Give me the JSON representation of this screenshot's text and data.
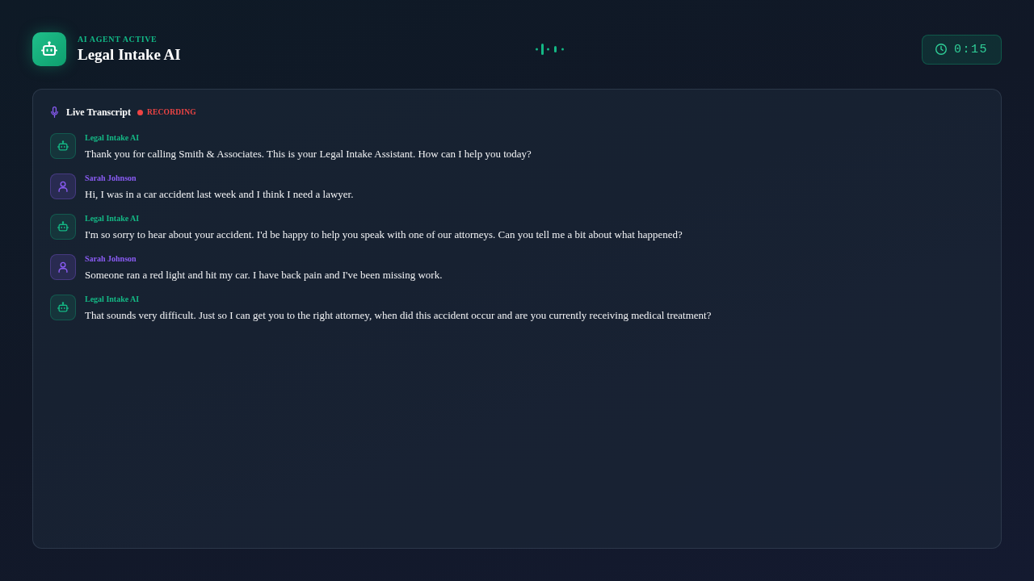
{
  "header": {
    "status_label": "AI AGENT ACTIVE",
    "title": "Legal Intake AI",
    "timer": "0:15"
  },
  "transcript": {
    "title": "Live Transcript",
    "status": "RECORDING",
    "messages": [
      {
        "kind": "agent",
        "speaker": "Legal Intake AI",
        "text": "Thank you for calling Smith & Associates. This is your Legal Intake Assistant. How can I help you today?"
      },
      {
        "kind": "caller",
        "speaker": "Sarah Johnson",
        "text": "Hi, I was in a car accident last week and I think I need a lawyer."
      },
      {
        "kind": "agent",
        "speaker": "Legal Intake AI",
        "text": "I'm so sorry to hear about your accident. I'd be happy to help you speak with one of our attorneys. Can you tell me a bit about what happened?"
      },
      {
        "kind": "caller",
        "speaker": "Sarah Johnson",
        "text": "Someone ran a red light and hit my car. I have back pain and I've been missing work."
      },
      {
        "kind": "agent",
        "speaker": "Legal Intake AI",
        "text": "That sounds very difficult. Just so I can get you to the right attorney, when did this accident occur and are you currently receiving medical treatment?"
      }
    ]
  }
}
